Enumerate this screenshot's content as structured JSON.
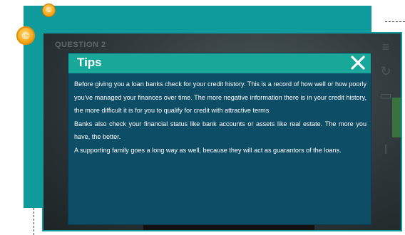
{
  "coins": {
    "small_symbol": "©",
    "large_symbol": "©"
  },
  "game": {
    "question_label": "QUESTION 2"
  },
  "tips": {
    "title": "Tips",
    "paragraphs": [
      "Before giving you a loan banks check for your credit history. This is a record of how well or how poorly you've managed your finances over time. The more negative information there is in your credit history, the more difficult it is for you to qualify for credit with attractive terms.",
      "Banks also check your financial status like bank accounts or assets like real estate. The more you have, the better.",
      "A supporting family goes a long way as well, because they will act as guarantors of the loans."
    ]
  },
  "colors": {
    "teal_panel": "#0f9b9b",
    "tips_background": "#0e4d66",
    "tips_header": "#17a89a",
    "coin": "#f7a81b"
  },
  "icons": [
    "coin-icon",
    "close-icon",
    "menu-icon",
    "refresh-icon",
    "screen-icon",
    "info-icon"
  ]
}
